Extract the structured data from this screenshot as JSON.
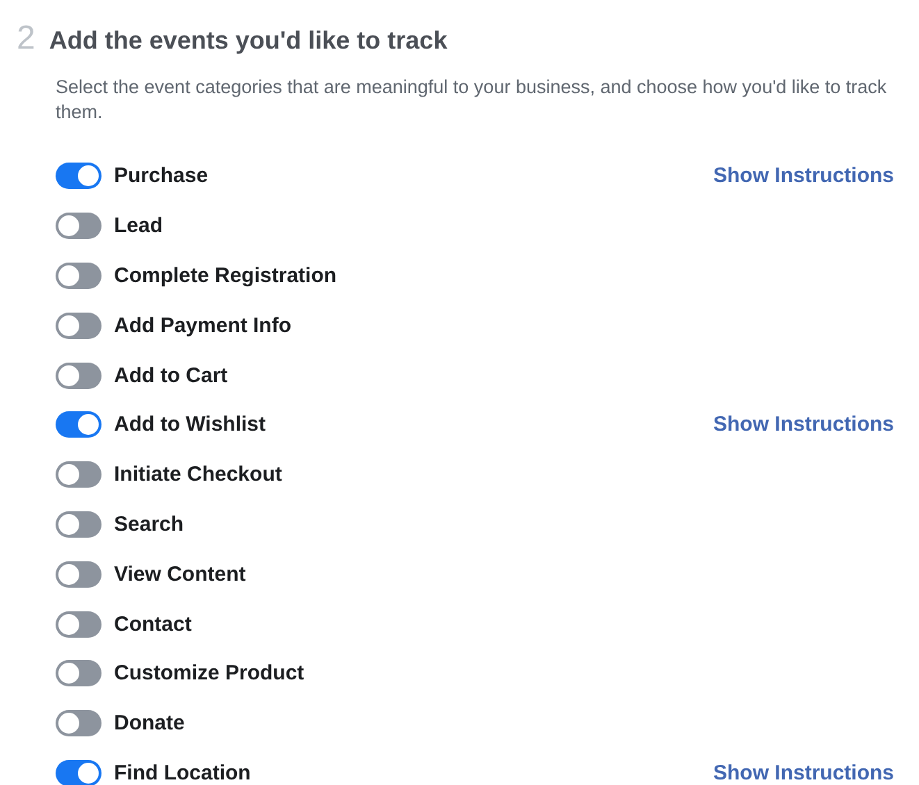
{
  "step": {
    "number": "2",
    "title": "Add the events you'd like to track",
    "description": "Select the event categories that are meaningful to your business, and choose how you'd like to track them."
  },
  "events": [
    {
      "label": "Purchase",
      "on": true,
      "link": "Show Instructions"
    },
    {
      "label": "Lead",
      "on": false
    },
    {
      "label": "Complete Registration",
      "on": false
    },
    {
      "label": "Add Payment Info",
      "on": false
    },
    {
      "label": "Add to Cart",
      "on": false
    },
    {
      "label": "Add to Wishlist",
      "on": true,
      "link": "Show Instructions"
    },
    {
      "label": "Initiate Checkout",
      "on": false
    },
    {
      "label": "Search",
      "on": false
    },
    {
      "label": "View Content",
      "on": false
    },
    {
      "label": "Contact",
      "on": false
    },
    {
      "label": "Customize Product",
      "on": false
    },
    {
      "label": "Donate",
      "on": false
    },
    {
      "label": "Find Location",
      "on": true,
      "link": "Show Instructions"
    }
  ]
}
